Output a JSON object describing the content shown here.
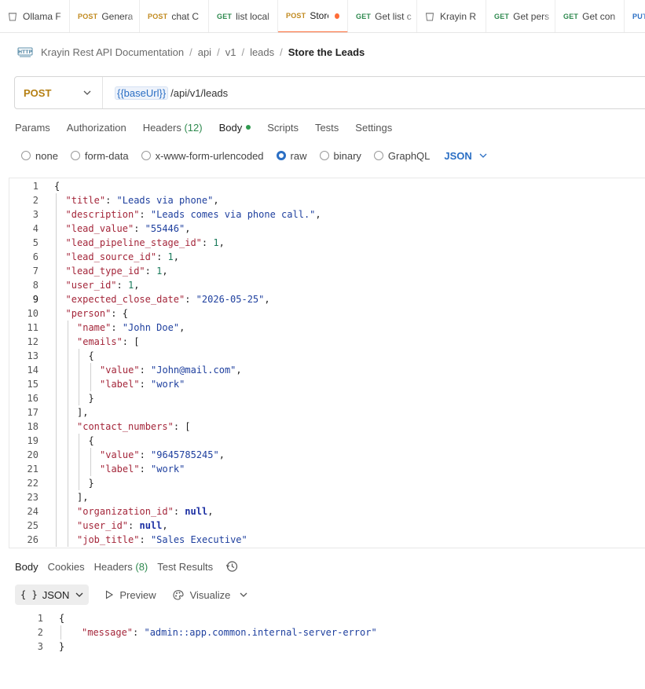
{
  "tabs": [
    {
      "method": "",
      "name": "Ollama F",
      "icon": "document-icon",
      "width": 89
    },
    {
      "method": "POST",
      "name": "Genera",
      "width": 89
    },
    {
      "method": "POST",
      "name": "chat C",
      "width": 88
    },
    {
      "method": "GET",
      "name": "list local",
      "width": 88
    },
    {
      "method": "POST",
      "name": "Store",
      "active": true,
      "unsaved": true,
      "width": 89
    },
    {
      "method": "GET",
      "name": "Get list c",
      "width": 88
    },
    {
      "method": "",
      "name": "Krayin R",
      "icon": "document-icon",
      "width": 88
    },
    {
      "method": "GET",
      "name": "Get pers",
      "width": 88
    },
    {
      "method": "GET",
      "name": "Get con",
      "width": 88
    },
    {
      "method": "PUT",
      "name": "",
      "width": 36
    }
  ],
  "breadcrumb": {
    "collection": "Krayin Rest API Documentation",
    "parts": [
      "api",
      "v1",
      "leads"
    ],
    "current": "Store the Leads"
  },
  "request": {
    "method": "POST",
    "url_var": "{{baseUrl}}",
    "url_path": "/api/v1/leads"
  },
  "request_tabs": {
    "params": "Params",
    "authorization": "Authorization",
    "headers": "Headers",
    "headers_count": "(12)",
    "body": "Body",
    "scripts": "Scripts",
    "tests": "Tests",
    "settings": "Settings"
  },
  "body_types": {
    "none": "none",
    "form_data": "form-data",
    "urlencoded": "x-www-form-urlencoded",
    "raw": "raw",
    "binary": "binary",
    "graphql": "GraphQL",
    "format": "JSON"
  },
  "request_body_lines": [
    {
      "n": "1",
      "indent": 0,
      "tokens": [
        [
          "p",
          "{"
        ]
      ]
    },
    {
      "n": "2",
      "indent": 1,
      "tokens": [
        [
          "k",
          "\"title\""
        ],
        [
          "p",
          ": "
        ],
        [
          "s",
          "\"Leads via phone\""
        ],
        [
          "p",
          ","
        ]
      ]
    },
    {
      "n": "3",
      "indent": 1,
      "tokens": [
        [
          "k",
          "\"description\""
        ],
        [
          "p",
          ": "
        ],
        [
          "s",
          "\"Leads comes via phone call.\""
        ],
        [
          "p",
          ","
        ]
      ]
    },
    {
      "n": "4",
      "indent": 1,
      "tokens": [
        [
          "k",
          "\"lead_value\""
        ],
        [
          "p",
          ": "
        ],
        [
          "s",
          "\"55446\""
        ],
        [
          "p",
          ","
        ]
      ]
    },
    {
      "n": "5",
      "indent": 1,
      "tokens": [
        [
          "k",
          "\"lead_pipeline_stage_id\""
        ],
        [
          "p",
          ": "
        ],
        [
          "n",
          "1"
        ],
        [
          "p",
          ","
        ]
      ]
    },
    {
      "n": "6",
      "indent": 1,
      "tokens": [
        [
          "k",
          "\"lead_source_id\""
        ],
        [
          "p",
          ": "
        ],
        [
          "n",
          "1"
        ],
        [
          "p",
          ","
        ]
      ]
    },
    {
      "n": "7",
      "indent": 1,
      "tokens": [
        [
          "k",
          "\"lead_type_id\""
        ],
        [
          "p",
          ": "
        ],
        [
          "n",
          "1"
        ],
        [
          "p",
          ","
        ]
      ]
    },
    {
      "n": "8",
      "indent": 1,
      "tokens": [
        [
          "k",
          "\"user_id\""
        ],
        [
          "p",
          ": "
        ],
        [
          "n",
          "1"
        ],
        [
          "p",
          ","
        ]
      ]
    },
    {
      "n": "9",
      "indent": 1,
      "current": true,
      "tokens": [
        [
          "k",
          "\"expected_close_date\""
        ],
        [
          "p",
          ": "
        ],
        [
          "s",
          "\"2026-05-25\""
        ],
        [
          "p",
          ","
        ]
      ]
    },
    {
      "n": "10",
      "indent": 1,
      "tokens": [
        [
          "k",
          "\"person\""
        ],
        [
          "p",
          ": {"
        ]
      ]
    },
    {
      "n": "11",
      "indent": 2,
      "tokens": [
        [
          "k",
          "\"name\""
        ],
        [
          "p",
          ": "
        ],
        [
          "s",
          "\"John Doe\""
        ],
        [
          "p",
          ","
        ]
      ]
    },
    {
      "n": "12",
      "indent": 2,
      "tokens": [
        [
          "k",
          "\"emails\""
        ],
        [
          "p",
          ": ["
        ]
      ]
    },
    {
      "n": "13",
      "indent": 3,
      "tokens": [
        [
          "p",
          "{"
        ]
      ]
    },
    {
      "n": "14",
      "indent": 4,
      "tokens": [
        [
          "k",
          "\"value\""
        ],
        [
          "p",
          ": "
        ],
        [
          "s",
          "\"John@mail.com\""
        ],
        [
          "p",
          ","
        ]
      ]
    },
    {
      "n": "15",
      "indent": 4,
      "tokens": [
        [
          "k",
          "\"label\""
        ],
        [
          "p",
          ": "
        ],
        [
          "s",
          "\"work\""
        ]
      ]
    },
    {
      "n": "16",
      "indent": 3,
      "tokens": [
        [
          "p",
          "}"
        ]
      ]
    },
    {
      "n": "17",
      "indent": 2,
      "tokens": [
        [
          "p",
          "],"
        ]
      ]
    },
    {
      "n": "18",
      "indent": 2,
      "tokens": [
        [
          "k",
          "\"contact_numbers\""
        ],
        [
          "p",
          ": ["
        ]
      ]
    },
    {
      "n": "19",
      "indent": 3,
      "tokens": [
        [
          "p",
          "{"
        ]
      ]
    },
    {
      "n": "20",
      "indent": 4,
      "tokens": [
        [
          "k",
          "\"value\""
        ],
        [
          "p",
          ": "
        ],
        [
          "s",
          "\"9645785245\""
        ],
        [
          "p",
          ","
        ]
      ]
    },
    {
      "n": "21",
      "indent": 4,
      "tokens": [
        [
          "k",
          "\"label\""
        ],
        [
          "p",
          ": "
        ],
        [
          "s",
          "\"work\""
        ]
      ]
    },
    {
      "n": "22",
      "indent": 3,
      "tokens": [
        [
          "p",
          "}"
        ]
      ]
    },
    {
      "n": "23",
      "indent": 2,
      "tokens": [
        [
          "p",
          "],"
        ]
      ]
    },
    {
      "n": "24",
      "indent": 2,
      "tokens": [
        [
          "k",
          "\"organization_id\""
        ],
        [
          "p",
          ": "
        ],
        [
          "kw",
          "null"
        ],
        [
          "p",
          ","
        ]
      ]
    },
    {
      "n": "25",
      "indent": 2,
      "tokens": [
        [
          "k",
          "\"user_id\""
        ],
        [
          "p",
          ": "
        ],
        [
          "kw",
          "null"
        ],
        [
          "p",
          ","
        ]
      ]
    },
    {
      "n": "26",
      "indent": 2,
      "tokens": [
        [
          "k",
          "\"job_title\""
        ],
        [
          "p",
          ": "
        ],
        [
          "s",
          "\"Sales Executive\""
        ]
      ]
    }
  ],
  "response_tabs": {
    "body": "Body",
    "cookies": "Cookies",
    "headers": "Headers",
    "headers_count": "(8)",
    "test_results": "Test Results"
  },
  "response_toolbar": {
    "format_brace": "{ }",
    "format": "JSON",
    "preview": "Preview",
    "visualize": "Visualize"
  },
  "response_body_lines": [
    {
      "n": "1",
      "indent": 0,
      "tokens": [
        [
          "p",
          "{"
        ]
      ]
    },
    {
      "n": "2",
      "indent": 1,
      "tokens": [
        [
          "k",
          "\"message\""
        ],
        [
          "p",
          ": "
        ],
        [
          "s",
          "\"admin::app.common.internal-server-error\""
        ]
      ]
    },
    {
      "n": "3",
      "indent": 0,
      "tokens": [
        [
          "p",
          "}"
        ]
      ]
    }
  ],
  "colors": {
    "accent": "#ff6c37",
    "post": "#c18a1f",
    "get": "#2f8a4f",
    "link_blue": "#2b6fc4"
  }
}
